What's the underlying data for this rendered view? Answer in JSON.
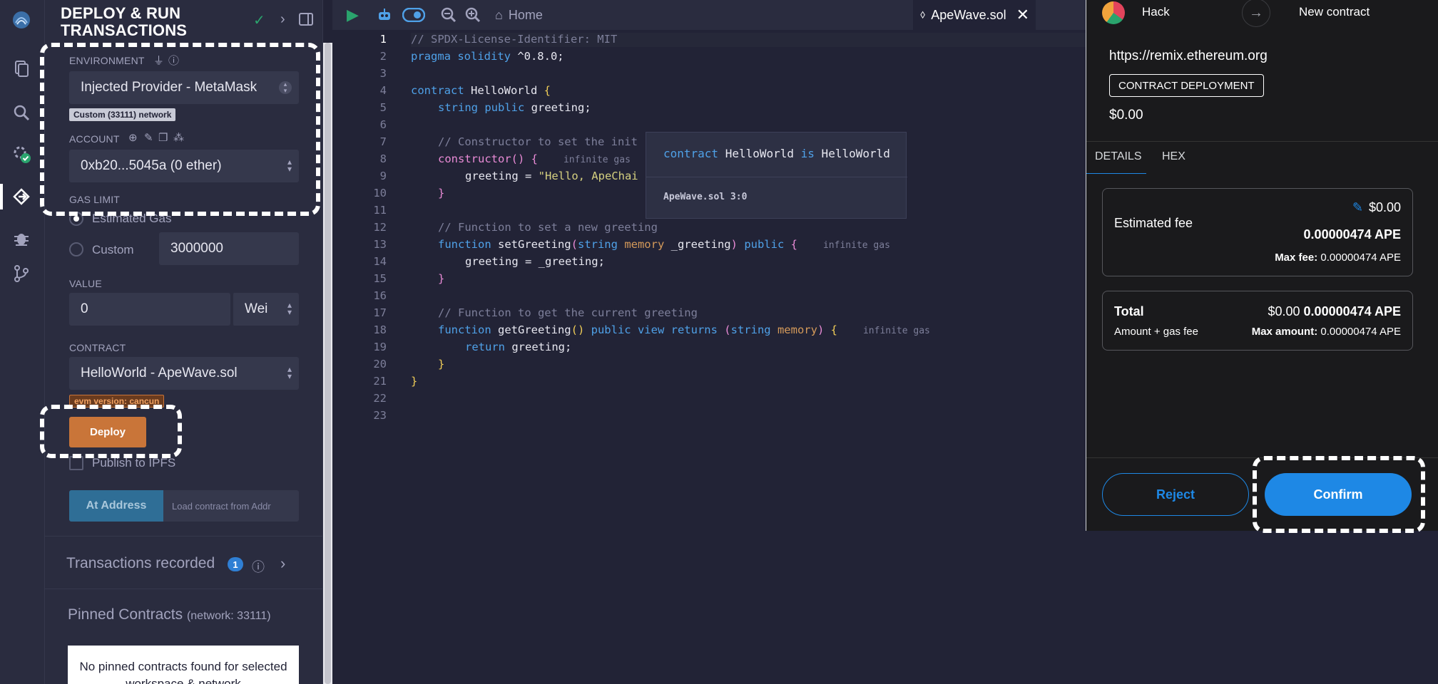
{
  "panel": {
    "title": "DEPLOY & RUN TRANSACTIONS",
    "environment_label": "ENVIRONMENT",
    "environment_value": "Injected Provider - MetaMask",
    "network_badge": "Custom (33111) network",
    "account_label": "ACCOUNT",
    "account_value": "0xb20...5045a (0 ether)",
    "gas_limit_label": "GAS LIMIT",
    "estimated_gas_label": "Estimated Gas",
    "custom_label": "Custom",
    "custom_gas_value": "3000000",
    "value_label": "VALUE",
    "value_amount": "0",
    "value_unit": "Wei",
    "contract_label": "CONTRACT",
    "contract_value": "HelloWorld - ApeWave.sol",
    "evm_badge": "evm version: cancun",
    "deploy_label": "Deploy",
    "publish_ipfs_label": "Publish to IPFS",
    "at_address_label": "At Address",
    "load_contract_placeholder": "Load contract from Addr",
    "transactions_recorded_label": "Transactions recorded",
    "transactions_count": "1",
    "pinned_title": "Pinned Contracts",
    "pinned_network": "(network: 33111)",
    "pinned_empty": "No pinned contracts found for selected workspace & network"
  },
  "toolbar": {
    "home_tab": "Home",
    "file_tab": "ApeWave.sol"
  },
  "editor": {
    "line_numbers": [
      "1",
      "2",
      "3",
      "4",
      "5",
      "6",
      "7",
      "8",
      "9",
      "10",
      "11",
      "12",
      "13",
      "14",
      "15",
      "16",
      "17",
      "18",
      "19",
      "20",
      "21",
      "22",
      "23"
    ],
    "lines": {
      "l1": "// SPDX-License-Identifier: MIT",
      "l2_kw": "pragma solidity",
      "l2_rest": " ^0.8.0;",
      "l4_kw": "contract",
      "l4_name": " HelloWorld ",
      "l4_brace": "{",
      "l5_kw": "string public",
      "l5_rest": " greeting;",
      "l7": "// Constructor to set the init",
      "l8_fn": "constructor",
      "l8_paren": "() {",
      "l8_gas": "infinite gas",
      "l9_a": "greeting = ",
      "l9_str": "\"Hello, ApeChai",
      "l10": "}",
      "l12": "// Function to set a new greeting",
      "l13_kw": "function",
      "l13_name": " setGreeting",
      "l13_open": "(",
      "l13_type": "string",
      "l13_mem": " memory",
      "l13_arg": " _greeting",
      "l13_close": ")",
      "l13_pub": " public",
      "l13_brace": " {",
      "l13_gas": "infinite gas",
      "l14": "greeting = _greeting;",
      "l15": "}",
      "l17": "// Function to get the current greeting",
      "l18_kw": "function",
      "l18_name": " getGreeting",
      "l18_paren": "()",
      "l18_pv": " public view",
      "l18_ret": " returns",
      "l18_open": " (",
      "l18_type": "string",
      "l18_mem": " memory",
      "l18_close": ")",
      "l18_brace": " {",
      "l18_gas": "infinite gas",
      "l19_kw": "return",
      "l19_rest": " greeting;",
      "l20": "}",
      "l21": "}"
    }
  },
  "tooltip": {
    "kw1": "contract",
    "name": " HelloWorld ",
    "kw2": "is",
    "name2": " HelloWorld",
    "location": "ApeWave.sol 3:0"
  },
  "metamask": {
    "account": "Hack",
    "new_contract": "New contract",
    "origin": "https://remix.ethereum.org",
    "tag": "CONTRACT DEPLOYMENT",
    "amount": "$0.00",
    "tab_details": "DETAILS",
    "tab_hex": "HEX",
    "estimated_fee_label": "Estimated fee",
    "estimated_fee_usd": "$0.00",
    "estimated_fee_ape": "0.00000474 APE",
    "max_fee_label": "Max fee:",
    "max_fee_value": "0.00000474 APE",
    "total_label": "Total",
    "total_usd": "$0.00",
    "total_ape": "0.00000474 APE",
    "amount_gas_label": "Amount + gas fee",
    "max_amount_label": "Max amount:",
    "max_amount_value": "0.00000474 APE",
    "reject_label": "Reject",
    "confirm_label": "Confirm"
  },
  "colors": {
    "accent_blue": "#1e88e5",
    "deploy_orange": "#c97539",
    "panel_bg": "#2a2c3f",
    "editor_bg": "#222336"
  },
  "icons": {
    "rail": [
      "remix-logo-icon",
      "file-explorer-icon",
      "search-icon",
      "solidity-compiler-icon",
      "deploy-run-icon",
      "debugger-icon",
      "git-icon"
    ]
  }
}
